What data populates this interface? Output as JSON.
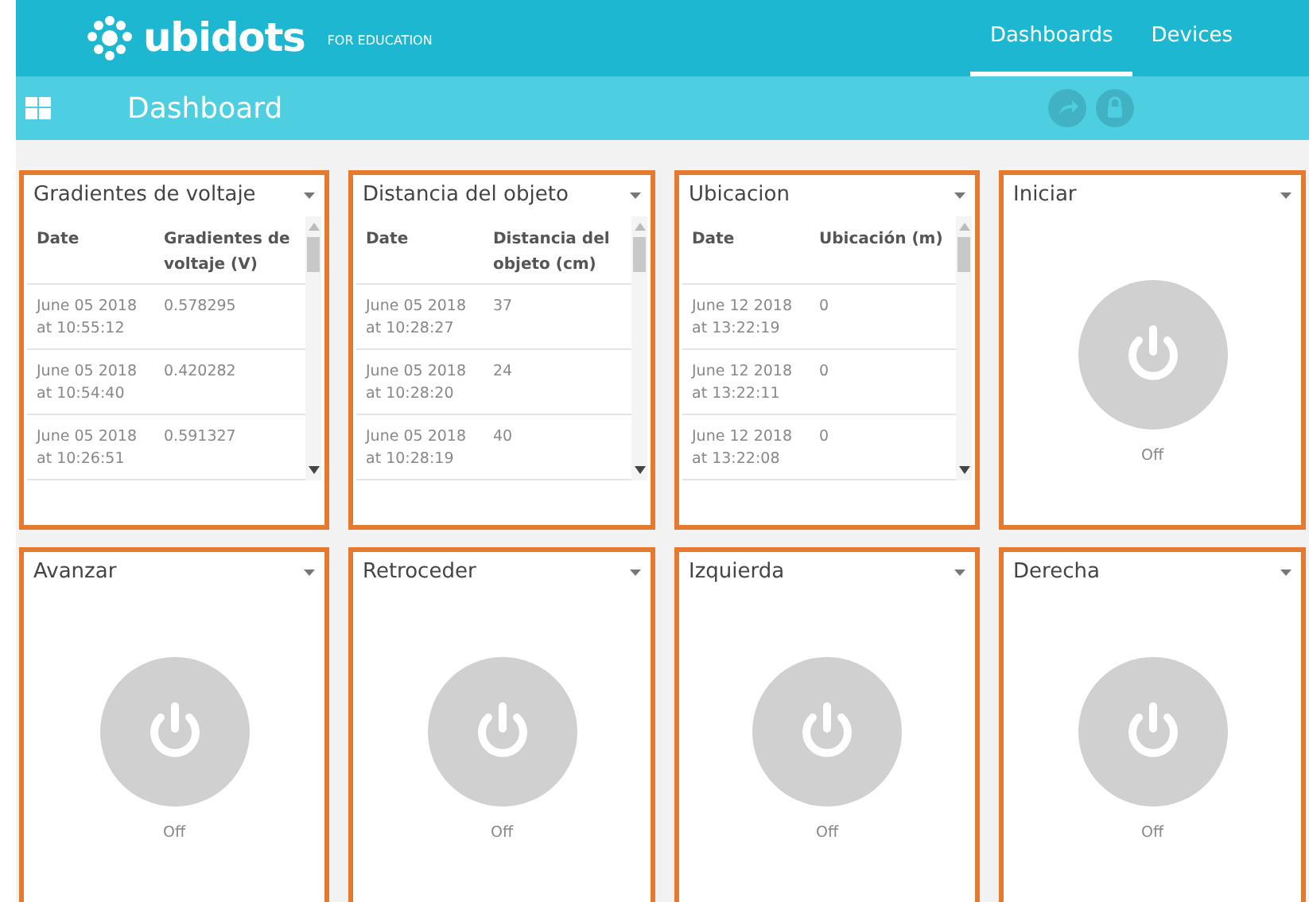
{
  "brand": {
    "name": "ubidots",
    "tagline": "FOR EDUCATION"
  },
  "nav": [
    {
      "label": "Dashboards",
      "selected": true
    },
    {
      "label": "Devices",
      "selected": false
    }
  ],
  "toolbar": {
    "title": "Dashboard"
  },
  "widgets": [
    {
      "kind": "table",
      "title": "Gradientes de voltaje",
      "columns": [
        "Date",
        "Gradientes de voltaje (V)"
      ],
      "rows": [
        [
          "June 05 2018 at 10:55:12",
          "0.578295"
        ],
        [
          "June 05 2018 at 10:54:40",
          "0.420282"
        ],
        [
          "June 05 2018 at 10:26:51",
          "0.591327"
        ]
      ]
    },
    {
      "kind": "table",
      "title": "Distancia del objeto",
      "columns": [
        "Date",
        "Distancia del objeto (cm)"
      ],
      "rows": [
        [
          "June 05 2018 at 10:28:27",
          "37"
        ],
        [
          "June 05 2018 at 10:28:20",
          "24"
        ],
        [
          "June 05 2018 at 10:28:19",
          "40"
        ]
      ]
    },
    {
      "kind": "table",
      "title": "Ubicacion",
      "columns": [
        "Date",
        "Ubicación (m)"
      ],
      "rows": [
        [
          "June 12 2018 at 13:22:19",
          "0"
        ],
        [
          "June 12 2018 at 13:22:11",
          "0"
        ],
        [
          "June 12 2018 at 13:22:08",
          "0"
        ]
      ]
    },
    {
      "kind": "switch",
      "title": "Iniciar",
      "on": false,
      "status": "Off"
    },
    {
      "kind": "switch",
      "title": "Avanzar",
      "on": false,
      "status": "Off"
    },
    {
      "kind": "switch",
      "title": "Retroceder",
      "on": false,
      "status": "Off"
    },
    {
      "kind": "switch",
      "title": "Izquierda",
      "on": false,
      "status": "Off"
    },
    {
      "kind": "switch",
      "title": "Derecha",
      "on": false,
      "status": "Off"
    }
  ]
}
